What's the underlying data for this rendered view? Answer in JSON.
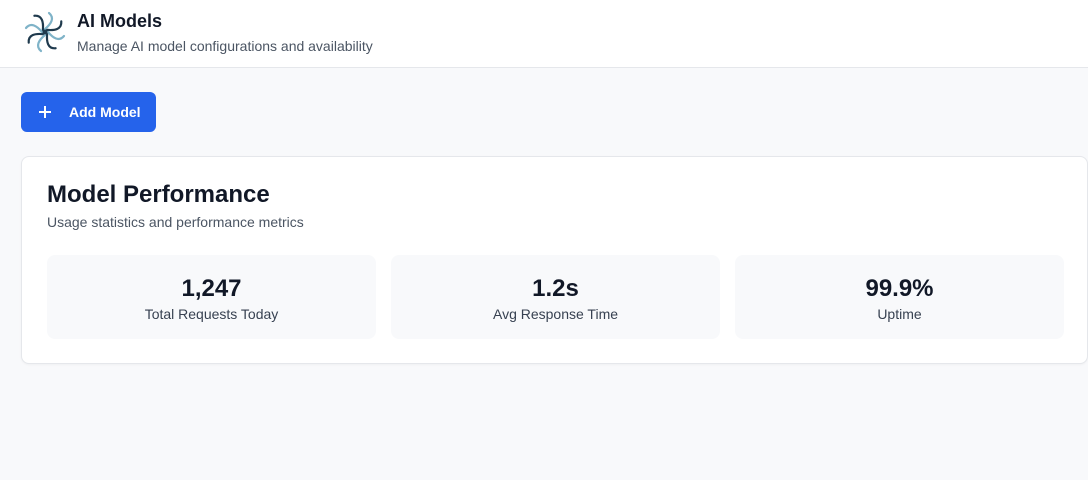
{
  "header": {
    "title": "AI Models",
    "subtitle": "Manage AI model configurations and availability",
    "logo_icon": "flower-swirl-logo-icon"
  },
  "toolbar": {
    "add_label": "Add Model",
    "add_icon": "plus-icon"
  },
  "performance": {
    "title": "Model Performance",
    "subtitle": "Usage statistics and performance metrics",
    "stats": [
      {
        "value": "1,247",
        "label": "Total Requests Today"
      },
      {
        "value": "1.2s",
        "label": "Avg Response Time"
      },
      {
        "value": "99.9%",
        "label": "Uptime"
      }
    ]
  },
  "colors": {
    "accent": "#2563eb",
    "background": "#f8f9fb",
    "card": "#ffffff",
    "logo_dark": "#1f3a4d",
    "logo_light": "#7fb3c8"
  }
}
